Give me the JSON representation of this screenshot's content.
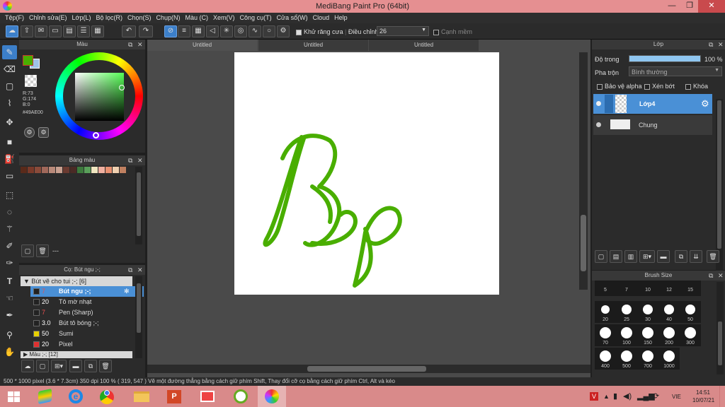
{
  "window": {
    "title": "MediBang Paint Pro (64bit)",
    "min": "—",
    "max": "❐",
    "close": "✕"
  },
  "menu": [
    "Tệp(F)",
    "Chỉnh sửa(E)",
    "Lớp(L)",
    "Bộ lọc(R)",
    "Chọn(S)",
    "Chụp(N)",
    "Màu (C)",
    "Xem(V)",
    "Công cụ(T)",
    "Cửa sổ(W)",
    "Cloud",
    "Help"
  ],
  "toolbar": {
    "anti_alias": "Khử răng cưa",
    "adjust": "Điều chỉnh",
    "adjust_value": "26",
    "soft_edge": "Cạnh mềm"
  },
  "color_panel": {
    "title": "Màu",
    "r": "R:73",
    "g": "G:174",
    "b": "B:0",
    "hex": "#49AE00",
    "primary": "#49AE00",
    "secondary": "#9fc3e6"
  },
  "palette_panel": {
    "title": "Bảng màu",
    "colors": [
      "#5a2a1a",
      "#7a3a2a",
      "#8a4b3a",
      "#a0685a",
      "#b98a7a",
      "#c8a090",
      "#6a3a30",
      "#4a2a25",
      "#3d7a3d",
      "#5aa05a",
      "#f0e6c0",
      "#f0b0a0",
      "#e89070",
      "#f0d0b0",
      "#c08060"
    ],
    "extra": "---"
  },
  "brush_list_panel": {
    "title": "Cọ: Bút ngu ;-;",
    "group": "Bút vẽ cho tui ;-; [6]",
    "items": [
      {
        "size": "7",
        "name": "Bút ngu ;-;",
        "color": "#222222",
        "num_color": "#e85050"
      },
      {
        "size": "20",
        "name": "Tô mờ nhạt",
        "color": "#222222",
        "num_color": "#ffffff"
      },
      {
        "size": "7",
        "name": "Pen (Sharp)",
        "color": "#222222",
        "num_color": "#e85050"
      },
      {
        "size": "3.0",
        "name": "Bút tô bóng ;-;",
        "color": "#222222",
        "num_color": "#ffffff"
      },
      {
        "size": "50",
        "name": "Sumi",
        "color": "#e8d000",
        "num_color": "#ffffff"
      },
      {
        "size": "20",
        "name": "Pixel",
        "color": "#e03030",
        "num_color": "#ffffff"
      }
    ],
    "group2": "Màu ;-; [12]"
  },
  "tabs": [
    "Untitled",
    "Untitled",
    "Untitled"
  ],
  "layer_panel": {
    "title": "Lớp",
    "opacity_label": "Độ trong",
    "opacity_value": "100 %",
    "blend_label": "Pha trộn",
    "blend_value": "Bình thường",
    "protect_alpha": "Bảo vệ alpha",
    "clipping": "Xén bớt",
    "lock": "Khóa",
    "layers": [
      {
        "name": "Lớp4",
        "selected": true
      },
      {
        "name": "Chung",
        "selected": false
      }
    ]
  },
  "brush_size_panel": {
    "title": "Brush Size",
    "sizes": [
      "5",
      "7",
      "10",
      "12",
      "15",
      "20",
      "25",
      "30",
      "40",
      "50",
      "70",
      "100",
      "150",
      "200",
      "300",
      "400",
      "500",
      "700",
      "1000"
    ]
  },
  "status": {
    "text": "500 * 1000 pixel  (3.6 * 7.3cm)  350 dpi  100 %  ( 319, 547 )  Vẽ một đường thẳng bằng cách giữ phím Shift, Thay đổi cỡ cọ bằng cách giữ phím Ctrl, Alt và kéo"
  },
  "taskbar": {
    "lang": "VIE",
    "time": "14:51",
    "date": "10/07/21"
  }
}
